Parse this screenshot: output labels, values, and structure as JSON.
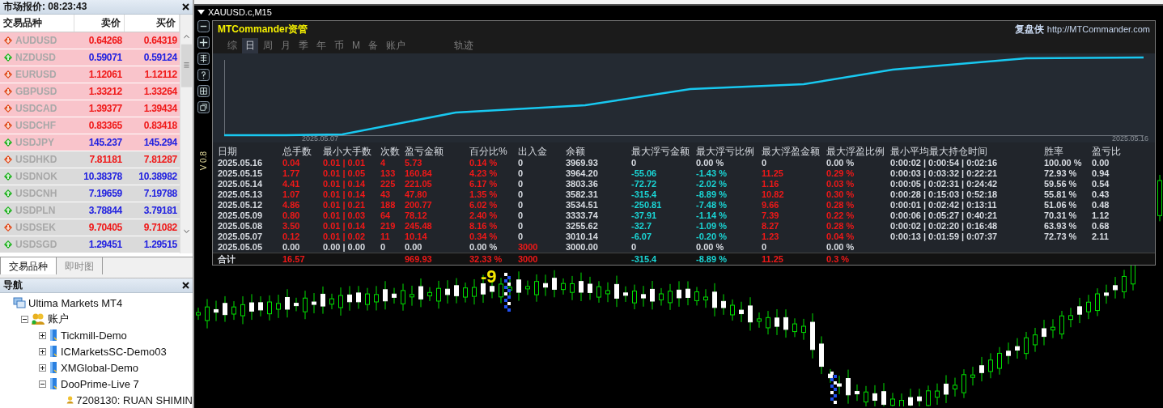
{
  "market_watch": {
    "title": "市场报价: 08:23:43",
    "columns": [
      "交易品种",
      "卖价",
      "买价"
    ],
    "rows": [
      {
        "symbol": "AUDUSD",
        "bid": "0.64268",
        "ask": "0.64319",
        "rising": false,
        "highlighted": true
      },
      {
        "symbol": "NZDUSD",
        "bid": "0.59071",
        "ask": "0.59124",
        "rising": true,
        "highlighted": true
      },
      {
        "symbol": "EURUSD",
        "bid": "1.12061",
        "ask": "1.12112",
        "rising": false,
        "highlighted": true
      },
      {
        "symbol": "GBPUSD",
        "bid": "1.33212",
        "ask": "1.33264",
        "rising": false,
        "highlighted": true
      },
      {
        "symbol": "USDCAD",
        "bid": "1.39377",
        "ask": "1.39434",
        "rising": false,
        "highlighted": true
      },
      {
        "symbol": "USDCHF",
        "bid": "0.83365",
        "ask": "0.83418",
        "rising": false,
        "highlighted": true
      },
      {
        "symbol": "USDJPY",
        "bid": "145.237",
        "ask": "145.294",
        "rising": true,
        "highlighted": true
      },
      {
        "symbol": "USDHKD",
        "bid": "7.81181",
        "ask": "7.81287",
        "rising": false,
        "highlighted": false
      },
      {
        "symbol": "USDNOK",
        "bid": "10.38378",
        "ask": "10.38982",
        "rising": true,
        "highlighted": false
      },
      {
        "symbol": "USDCNH",
        "bid": "7.19659",
        "ask": "7.19788",
        "rising": true,
        "highlighted": false
      },
      {
        "symbol": "USDPLN",
        "bid": "3.78844",
        "ask": "3.79181",
        "rising": true,
        "highlighted": false
      },
      {
        "symbol": "USDSEK",
        "bid": "9.70405",
        "ask": "9.71082",
        "rising": false,
        "highlighted": false
      },
      {
        "symbol": "USDSGD",
        "bid": "1.29451",
        "ask": "1.29515",
        "rising": true,
        "highlighted": false
      }
    ],
    "tabs": [
      {
        "label": "交易品种",
        "selected": true
      },
      {
        "label": "即时图",
        "selected": false
      }
    ]
  },
  "navigator": {
    "title": "导航",
    "tree": [
      {
        "label": "Ultima Markets MT4",
        "kind": "platform",
        "children": [
          {
            "label": "账户",
            "kind": "accounts",
            "expanded": true,
            "children": [
              {
                "label": "Tickmill-Demo",
                "kind": "server",
                "expanded": false
              },
              {
                "label": "ICMarketsSC-Demo03",
                "kind": "server",
                "expanded": false
              },
              {
                "label": "XMGlobal-Demo",
                "kind": "server",
                "expanded": false
              },
              {
                "label": "DooPrime-Live 7",
                "kind": "server",
                "expanded": true,
                "children": [
                  {
                    "label": "7208130: RUAN SHIMIN",
                    "kind": "user"
                  }
                ]
              }
            ]
          }
        ]
      }
    ]
  },
  "chart_window": {
    "title": "XAUUSD.c,M15",
    "label": "-9",
    "version": "V 0.8",
    "panel": {
      "brand": "MTCommander资管",
      "site_name": "复盘侠",
      "site_url": "http://MTCommander.com",
      "tabs": [
        {
          "label": "综",
          "selected": false
        },
        {
          "label": "日",
          "selected": true
        },
        {
          "label": "周",
          "selected": false
        },
        {
          "label": "月",
          "selected": false
        },
        {
          "label": "季",
          "selected": false
        },
        {
          "label": "年",
          "selected": false
        },
        {
          "label": "币",
          "selected": false
        },
        {
          "label": "M",
          "selected": false
        },
        {
          "label": "备",
          "selected": false
        },
        {
          "label": "账户",
          "selected": false
        }
      ],
      "track_tab": {
        "label": "轨迹",
        "selected": false
      },
      "equity_chart": {
        "start_label": "2025.05.07",
        "end_label": "2025.05.16"
      },
      "table": {
        "columns": [
          "日期",
          "总手数",
          "最小大手数",
          "次数",
          "盈亏金额",
          "百分比%",
          "出入金",
          "余额",
          "最大浮亏金额",
          "最大浮亏比例",
          "最大浮盈金额",
          "最大浮盈比例",
          "最小平均最大持仓时间",
          "胜率",
          "盈亏比"
        ],
        "rows": [
          {
            "kind": "day",
            "cells": [
              {
                "text": "2025.05.16",
                "color": "#d8dce2"
              },
              {
                "text": "0.04",
                "color": "#f01818"
              },
              {
                "text": "0.01 | 0.01",
                "color": "#f01818"
              },
              {
                "text": "4",
                "color": "#f01818"
              },
              {
                "text": "5.73",
                "color": "#f01818"
              },
              {
                "text": "0.14 %",
                "color": "#f01818"
              },
              {
                "text": "0",
                "color": "#d8dce2"
              },
              {
                "text": "3969.93",
                "color": "#d8dce2"
              },
              {
                "text": "0",
                "color": "#d8dce2"
              },
              {
                "text": "0.00 %",
                "color": "#d8dce2"
              },
              {
                "text": "0",
                "color": "#d8dce2"
              },
              {
                "text": "0.00 %",
                "color": "#d8dce2"
              },
              {
                "text": "0:00:02 | 0:00:54 | 0:02:16",
                "color": "#d8dce2"
              },
              {
                "text": "100.00 %",
                "color": "#d8dce2"
              },
              {
                "text": "0.00",
                "color": "#d8dce2"
              }
            ]
          },
          {
            "kind": "day",
            "cells": [
              {
                "text": "2025.05.15",
                "color": "#d8dce2"
              },
              {
                "text": "1.77",
                "color": "#f01818"
              },
              {
                "text": "0.01 | 0.05",
                "color": "#f01818"
              },
              {
                "text": "133",
                "color": "#f01818"
              },
              {
                "text": "160.84",
                "color": "#f01818"
              },
              {
                "text": "4.23 %",
                "color": "#f01818"
              },
              {
                "text": "0",
                "color": "#d8dce2"
              },
              {
                "text": "3964.20",
                "color": "#d8dce2"
              },
              {
                "text": "-55.06",
                "color": "#1ad6d6"
              },
              {
                "text": "-1.43 %",
                "color": "#1ad6d6"
              },
              {
                "text": "11.25",
                "color": "#f01818"
              },
              {
                "text": "0.29 %",
                "color": "#f01818"
              },
              {
                "text": "0:00:03 | 0:03:32 | 0:22:21",
                "color": "#d8dce2"
              },
              {
                "text": "72.93 %",
                "color": "#d8dce2"
              },
              {
                "text": "0.94",
                "color": "#d8dce2"
              }
            ]
          },
          {
            "kind": "day",
            "cells": [
              {
                "text": "2025.05.14",
                "color": "#d8dce2"
              },
              {
                "text": "4.41",
                "color": "#f01818"
              },
              {
                "text": "0.01 | 0.14",
                "color": "#f01818"
              },
              {
                "text": "225",
                "color": "#f01818"
              },
              {
                "text": "221.05",
                "color": "#f01818"
              },
              {
                "text": "6.17 %",
                "color": "#f01818"
              },
              {
                "text": "0",
                "color": "#d8dce2"
              },
              {
                "text": "3803.36",
                "color": "#d8dce2"
              },
              {
                "text": "-72.72",
                "color": "#1ad6d6"
              },
              {
                "text": "-2.02 %",
                "color": "#1ad6d6"
              },
              {
                "text": "1.16",
                "color": "#f01818"
              },
              {
                "text": "0.03 %",
                "color": "#f01818"
              },
              {
                "text": "0:00:05 | 0:02:31 | 0:24:42",
                "color": "#d8dce2"
              },
              {
                "text": "59.56 %",
                "color": "#d8dce2"
              },
              {
                "text": "0.54",
                "color": "#d8dce2"
              }
            ]
          },
          {
            "kind": "day",
            "cells": [
              {
                "text": "2025.05.13",
                "color": "#d8dce2"
              },
              {
                "text": "1.07",
                "color": "#f01818"
              },
              {
                "text": "0.01 | 0.14",
                "color": "#f01818"
              },
              {
                "text": "43",
                "color": "#f01818"
              },
              {
                "text": "47.80",
                "color": "#f01818"
              },
              {
                "text": "1.35 %",
                "color": "#f01818"
              },
              {
                "text": "0",
                "color": "#d8dce2"
              },
              {
                "text": "3582.31",
                "color": "#d8dce2"
              },
              {
                "text": "-315.4",
                "color": "#1ad6d6"
              },
              {
                "text": "-8.89 %",
                "color": "#1ad6d6"
              },
              {
                "text": "10.82",
                "color": "#f01818"
              },
              {
                "text": "0.30 %",
                "color": "#f01818"
              },
              {
                "text": "0:00:28 | 0:15:03 | 0:52:18",
                "color": "#d8dce2"
              },
              {
                "text": "55.81 %",
                "color": "#d8dce2"
              },
              {
                "text": "0.43",
                "color": "#d8dce2"
              }
            ]
          },
          {
            "kind": "day",
            "cells": [
              {
                "text": "2025.05.12",
                "color": "#d8dce2"
              },
              {
                "text": "4.86",
                "color": "#f01818"
              },
              {
                "text": "0.01 | 0.21",
                "color": "#f01818"
              },
              {
                "text": "188",
                "color": "#f01818"
              },
              {
                "text": "200.77",
                "color": "#f01818"
              },
              {
                "text": "6.02 %",
                "color": "#f01818"
              },
              {
                "text": "0",
                "color": "#d8dce2"
              },
              {
                "text": "3534.51",
                "color": "#d8dce2"
              },
              {
                "text": "-250.81",
                "color": "#1ad6d6"
              },
              {
                "text": "-7.48 %",
                "color": "#1ad6d6"
              },
              {
                "text": "9.66",
                "color": "#f01818"
              },
              {
                "text": "0.28 %",
                "color": "#f01818"
              },
              {
                "text": "0:00:01 | 0:02:42 | 0:13:11",
                "color": "#d8dce2"
              },
              {
                "text": "51.06 %",
                "color": "#d8dce2"
              },
              {
                "text": "0.48",
                "color": "#d8dce2"
              }
            ]
          },
          {
            "kind": "day",
            "cells": [
              {
                "text": "2025.05.09",
                "color": "#d8dce2"
              },
              {
                "text": "0.80",
                "color": "#f01818"
              },
              {
                "text": "0.01 | 0.03",
                "color": "#f01818"
              },
              {
                "text": "64",
                "color": "#f01818"
              },
              {
                "text": "78.12",
                "color": "#f01818"
              },
              {
                "text": "2.40 %",
                "color": "#f01818"
              },
              {
                "text": "0",
                "color": "#d8dce2"
              },
              {
                "text": "3333.74",
                "color": "#d8dce2"
              },
              {
                "text": "-37.91",
                "color": "#1ad6d6"
              },
              {
                "text": "-1.14 %",
                "color": "#1ad6d6"
              },
              {
                "text": "7.39",
                "color": "#f01818"
              },
              {
                "text": "0.22 %",
                "color": "#f01818"
              },
              {
                "text": "0:00:06 | 0:05:27 | 0:40:21",
                "color": "#d8dce2"
              },
              {
                "text": "70.31 %",
                "color": "#d8dce2"
              },
              {
                "text": "1.12",
                "color": "#d8dce2"
              }
            ]
          },
          {
            "kind": "day",
            "cells": [
              {
                "text": "2025.05.08",
                "color": "#d8dce2"
              },
              {
                "text": "3.50",
                "color": "#f01818"
              },
              {
                "text": "0.01 | 0.14",
                "color": "#f01818"
              },
              {
                "text": "219",
                "color": "#f01818"
              },
              {
                "text": "245.48",
                "color": "#f01818"
              },
              {
                "text": "8.16 %",
                "color": "#f01818"
              },
              {
                "text": "0",
                "color": "#d8dce2"
              },
              {
                "text": "3255.62",
                "color": "#d8dce2"
              },
              {
                "text": "-32.7",
                "color": "#1ad6d6"
              },
              {
                "text": "-1.09 %",
                "color": "#1ad6d6"
              },
              {
                "text": "8.27",
                "color": "#f01818"
              },
              {
                "text": "0.28 %",
                "color": "#f01818"
              },
              {
                "text": "0:00:02 | 0:02:20 | 0:16:48",
                "color": "#d8dce2"
              },
              {
                "text": "63.93 %",
                "color": "#d8dce2"
              },
              {
                "text": "0.68",
                "color": "#d8dce2"
              }
            ]
          },
          {
            "kind": "day",
            "cells": [
              {
                "text": "2025.05.07",
                "color": "#d8dce2"
              },
              {
                "text": "0.12",
                "color": "#f01818"
              },
              {
                "text": "0.01 | 0.02",
                "color": "#f01818"
              },
              {
                "text": "11",
                "color": "#f01818"
              },
              {
                "text": "10.14",
                "color": "#f01818"
              },
              {
                "text": "0.34 %",
                "color": "#f01818"
              },
              {
                "text": "0",
                "color": "#d8dce2"
              },
              {
                "text": "3010.14",
                "color": "#d8dce2"
              },
              {
                "text": "-6.07",
                "color": "#1ad6d6"
              },
              {
                "text": "-0.20 %",
                "color": "#1ad6d6"
              },
              {
                "text": "1.23",
                "color": "#f01818"
              },
              {
                "text": "0.04 %",
                "color": "#f01818"
              },
              {
                "text": "0:00:13 | 0:01:59 | 0:07:37",
                "color": "#d8dce2"
              },
              {
                "text": "72.73 %",
                "color": "#d8dce2"
              },
              {
                "text": "2.11",
                "color": "#d8dce2"
              }
            ]
          },
          {
            "kind": "day",
            "cells": [
              {
                "text": "2025.05.05",
                "color": "#d8dce2"
              },
              {
                "text": "0.00",
                "color": "#d8dce2"
              },
              {
                "text": "0.00 | 0.00",
                "color": "#d8dce2"
              },
              {
                "text": "0",
                "color": "#d8dce2"
              },
              {
                "text": "0.00",
                "color": "#d8dce2"
              },
              {
                "text": "0.00 %",
                "color": "#d8dce2"
              },
              {
                "text": "3000",
                "color": "#f01818"
              },
              {
                "text": "3000.00",
                "color": "#d8dce2"
              },
              {
                "text": "0",
                "color": "#d8dce2"
              },
              {
                "text": "0.00 %",
                "color": "#d8dce2"
              },
              {
                "text": "0",
                "color": "#d8dce2"
              },
              {
                "text": "0.00 %",
                "color": "#d8dce2"
              },
              null,
              null,
              null
            ]
          },
          {
            "kind": "total",
            "cells": [
              {
                "text": "合计",
                "color": "#d8dce2"
              },
              {
                "text": "16.57",
                "color": "#f01818"
              },
              null,
              null,
              {
                "text": "969.93",
                "color": "#f01818"
              },
              {
                "text": "32.33 %",
                "color": "#f01818"
              },
              {
                "text": "3000",
                "color": "#f01818"
              },
              null,
              {
                "text": "-315.4",
                "color": "#1ad6d6"
              },
              {
                "text": "-8.89 %",
                "color": "#1ad6d6"
              },
              {
                "text": "11.25",
                "color": "#f01818"
              },
              {
                "text": "0.3 %",
                "color": "#f01818"
              },
              null,
              null,
              null
            ]
          }
        ]
      }
    }
  }
}
